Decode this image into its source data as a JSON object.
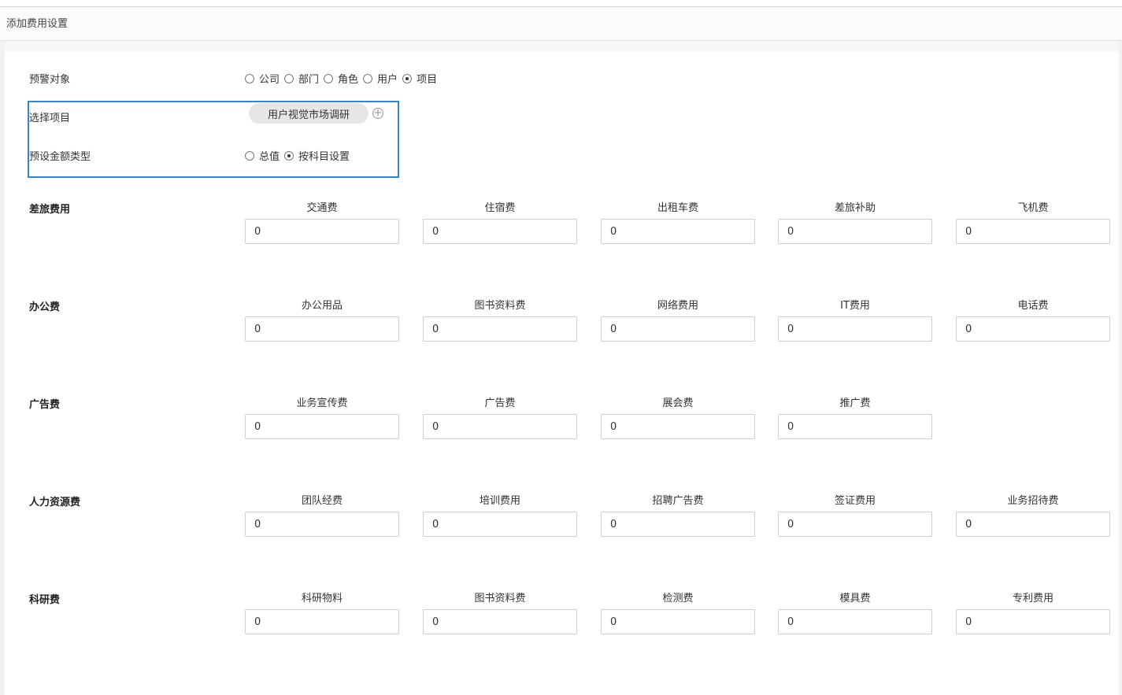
{
  "header": {
    "title": "添加费用设置"
  },
  "warning_target": {
    "label": "预警对象",
    "options": [
      "公司",
      "部门",
      "角色",
      "用户",
      "项目"
    ],
    "selected": 4
  },
  "select_project": {
    "label": "选择项目",
    "tag": "用户视觉市场调研",
    "add_icon": "plus-circle-icon"
  },
  "amount_type": {
    "label": "预设金额类型",
    "options": [
      "总值",
      "按科目设置"
    ],
    "selected": 1
  },
  "categories": [
    {
      "name": "差旅费用",
      "fields": [
        {
          "label": "交通费",
          "value": "0"
        },
        {
          "label": "住宿费",
          "value": "0"
        },
        {
          "label": "出租车费",
          "value": "0"
        },
        {
          "label": "差旅补助",
          "value": "0"
        },
        {
          "label": "飞机费",
          "value": "0"
        }
      ]
    },
    {
      "name": "办公费",
      "fields": [
        {
          "label": "办公用品",
          "value": "0"
        },
        {
          "label": "图书资料费",
          "value": "0"
        },
        {
          "label": "网络费用",
          "value": "0"
        },
        {
          "label": "IT费用",
          "value": "0"
        },
        {
          "label": "电话费",
          "value": "0"
        }
      ]
    },
    {
      "name": "广告费",
      "fields": [
        {
          "label": "业务宣传费",
          "value": "0"
        },
        {
          "label": "广告费",
          "value": "0"
        },
        {
          "label": "展会费",
          "value": "0"
        },
        {
          "label": "推广费",
          "value": "0"
        }
      ]
    },
    {
      "name": "人力资源费",
      "fields": [
        {
          "label": "团队经费",
          "value": "0"
        },
        {
          "label": "培训费用",
          "value": "0"
        },
        {
          "label": "招聘广告费",
          "value": "0"
        },
        {
          "label": "签证费用",
          "value": "0"
        },
        {
          "label": "业务招待费",
          "value": "0"
        }
      ]
    },
    {
      "name": "科研费",
      "fields": [
        {
          "label": "科研物料",
          "value": "0"
        },
        {
          "label": "图书资料费",
          "value": "0"
        },
        {
          "label": "检测费",
          "value": "0"
        },
        {
          "label": "模具费",
          "value": "0"
        },
        {
          "label": "专利费用",
          "value": "0"
        }
      ]
    }
  ]
}
